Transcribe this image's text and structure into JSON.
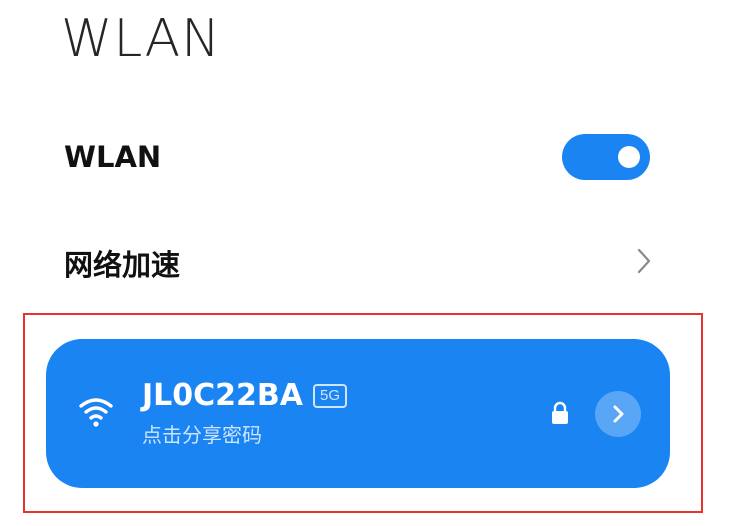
{
  "header": {
    "title": "WLAN"
  },
  "settings": {
    "wlan": {
      "label": "WLAN",
      "toggle_on": true
    },
    "network_acceleration": {
      "label": "网络加速"
    }
  },
  "connected_network": {
    "ssid": "JL0C22BA",
    "band": "5G",
    "subtitle": "点击分享密码",
    "secured": true
  },
  "colors": {
    "accent": "#1a84f3",
    "highlight_border": "#e8322e",
    "subtitle_text": "#cfe4fd"
  },
  "icons": {
    "wifi": "wifi-icon",
    "lock": "lock-icon",
    "chevron": "chevron-right-icon",
    "card_arrow": "arrow-right-icon"
  }
}
